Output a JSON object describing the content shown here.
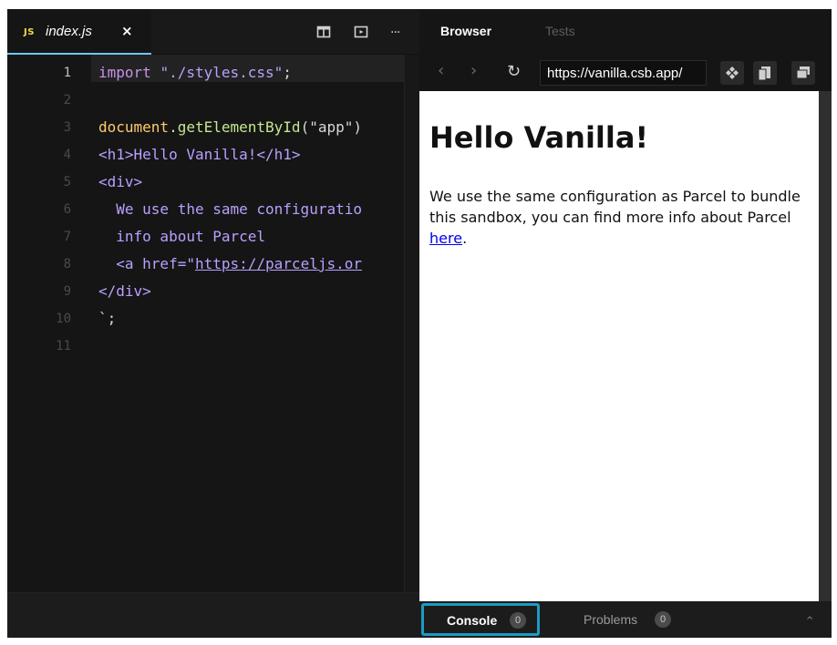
{
  "editor": {
    "tab": {
      "icon_label": "JS",
      "filename": "index.js",
      "close": "×"
    },
    "toolbar_icons": [
      "split-view-icon",
      "preview-icon",
      "more-icon"
    ],
    "more_label": "···",
    "line_numbers": [
      "1",
      "2",
      "3",
      "4",
      "5",
      "6",
      "7",
      "8",
      "9",
      "10",
      "11"
    ],
    "code": {
      "l1_kw": "import",
      "l1_str": "\"./styles.css\"",
      "l1_end": ";",
      "l3_obj": "document",
      "l3_dot": ".",
      "l3_fn": "getElementById",
      "l3_args": "(\"app\")",
      "l4": "<h1>Hello Vanilla!</h1>",
      "l5": "<div>",
      "l6": "  We use the same configuratio",
      "l7": "  info about Parcel",
      "l8_pre": "  <a href=\"",
      "l8_link": "https://parceljs.or",
      "l9": "</div>",
      "l10": "`;"
    }
  },
  "preview": {
    "tabs": {
      "browser": "Browser",
      "tests": "Tests"
    },
    "nav": {
      "back": "‹",
      "forward": "›",
      "refresh": "↻",
      "url": "https://vanilla.csb.app/"
    },
    "page": {
      "heading": "Hello Vanilla!",
      "paragraph": "We use the same configuration as Parcel to bundle this sandbox, you can find more info about Parcel ",
      "link_text": "here",
      "trailing": "."
    },
    "bottom": {
      "console_label": "Console",
      "console_count": "0",
      "problems_label": "Problems",
      "problems_count": "0",
      "collapse": "^"
    }
  },
  "colors": {
    "accent": "#1d9bc2",
    "editor_bg": "#151515",
    "js_icon": "#f5d94a"
  }
}
